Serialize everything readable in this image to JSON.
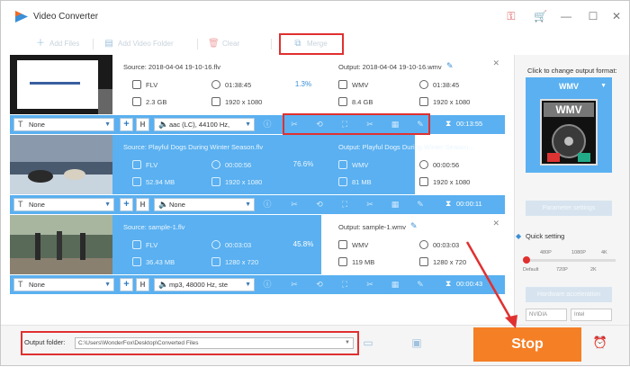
{
  "window": {
    "title": "Video Converter"
  },
  "toolbar": {
    "add_files": "Add Files",
    "add_video_folder": "Add Video Folder",
    "clear": "Clear",
    "merge": "Merge"
  },
  "files": [
    {
      "source_name": "Source: 2018-04-04 19-10-16.flv",
      "src_format": "FLV",
      "src_duration": "01:38:45",
      "src_size": "2.3 GB",
      "src_resolution": "1920 x 1080",
      "progress": "1.3%",
      "output_name": "Output: 2018-04-04 19-10-16.wmv",
      "dst_format": "WMV",
      "dst_duration": "01:38:45",
      "dst_size": "8.4 GB",
      "dst_resolution": "1920 x 1080",
      "subtitle": "None",
      "audio": "aac (LC), 44100 Hz,",
      "time": "00:13:55"
    },
    {
      "source_name": "Source: Playful Dogs During Winter Season.flv",
      "src_format": "FLV",
      "src_duration": "00:00:56",
      "src_size": "52.94 MB",
      "src_resolution": "1920 x 1080",
      "progress": "76.6%",
      "output_name": "Output: Playful Dogs During Winter Season...",
      "dst_format": "WMV",
      "dst_duration": "00:00:56",
      "dst_size": "81 MB",
      "dst_resolution": "1920 x 1080",
      "subtitle": "None",
      "audio": "None",
      "time": "00:00:11"
    },
    {
      "source_name": "Source: sample-1.flv",
      "src_format": "FLV",
      "src_duration": "00:03:03",
      "src_size": "36.43 MB",
      "src_resolution": "1280 x 720",
      "progress": "45.8%",
      "output_name": "Output: sample-1.wmv",
      "dst_format": "WMV",
      "dst_duration": "00:03:03",
      "dst_size": "119 MB",
      "dst_resolution": "1280 x 720",
      "subtitle": "None",
      "audio": "mp3, 48000 Hz, ste",
      "time": "00:00:43"
    }
  ],
  "right_panel": {
    "change_label": "Click to change output format:",
    "format": "WMV",
    "format_icon_text": "WMV",
    "parameter_settings": "Parameter settings",
    "quick_setting": "Quick setting",
    "ticks_top": [
      "480P",
      "1080P",
      "4K"
    ],
    "ticks_bottom": [
      "Default",
      "720P",
      "2K"
    ],
    "hardware_acceleration": "Hardware acceleration",
    "chips": [
      "NVIDIA",
      "Intel"
    ]
  },
  "bottom": {
    "output_folder_label": "Output folder:",
    "output_path": "C:\\Users\\WonderFox\\Desktop\\Converted Files",
    "stop": "Stop"
  },
  "colors": {
    "accent": "#5ab0f0",
    "stop": "#f57f25",
    "highlight": "#e03030"
  }
}
